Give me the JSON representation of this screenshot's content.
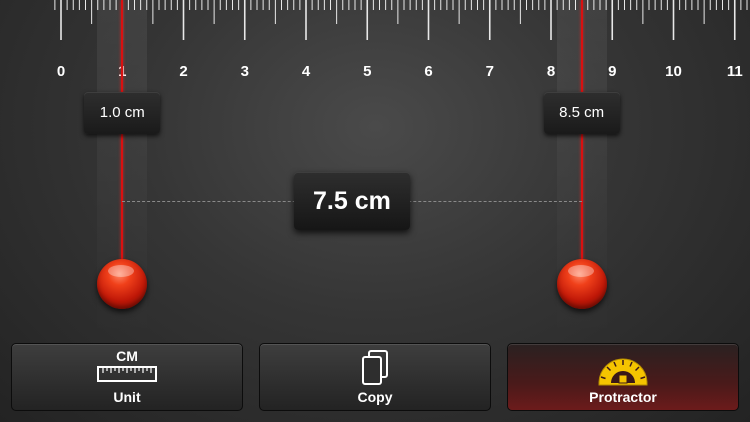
{
  "ruler": {
    "unit": "cm",
    "numbers": [
      "0",
      "1",
      "2",
      "3",
      "4",
      "5",
      "6",
      "7",
      "8",
      "9",
      "10",
      "11"
    ]
  },
  "markers": {
    "left": {
      "value_cm": 1.0,
      "label": "1.0 cm"
    },
    "right": {
      "value_cm": 8.5,
      "label": "8.5 cm"
    }
  },
  "distance": {
    "label": "7.5 cm"
  },
  "toolbar": {
    "unit": {
      "caption": "CM",
      "label": "Unit",
      "icon": "ruler-icon"
    },
    "copy": {
      "label": "Copy",
      "icon": "copy-icon"
    },
    "protractor": {
      "label": "Protractor",
      "icon": "protractor-icon",
      "active": true
    }
  },
  "colors": {
    "laser": "#d91010",
    "knob": "#d02010",
    "protractor_icon": "#f5c400",
    "active_button": "#6c1b1b"
  }
}
